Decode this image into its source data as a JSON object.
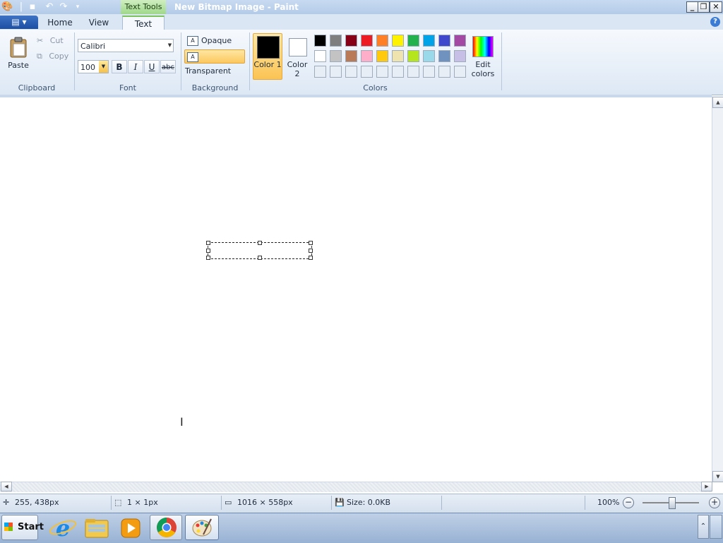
{
  "window": {
    "title": "New Bitmap Image - Paint",
    "contextual_tab": "Text Tools"
  },
  "tabs": [
    "Home",
    "View",
    "Text"
  ],
  "active_tab": "Text",
  "ribbon": {
    "clipboard": {
      "paste": "Paste",
      "cut": "Cut",
      "copy": "Copy",
      "label": "Clipboard"
    },
    "font": {
      "family": "Calibri",
      "size": "100",
      "bold": "B",
      "italic": "I",
      "underline": "U",
      "strike": "abc",
      "label": "Font"
    },
    "background": {
      "opaque": "Opaque",
      "transparent": "Transparent",
      "label": "Background",
      "selected": "Transparent"
    },
    "colors": {
      "color1_label": "Color 1",
      "color2_label": "Color 2",
      "edit_label": "Edit colors",
      "label": "Colors",
      "color1": "#000000",
      "color2": "#ffffff",
      "palette_row1": [
        "#000000",
        "#7f7f7f",
        "#880015",
        "#ed1c24",
        "#ff7f27",
        "#fff200",
        "#22b14c",
        "#00a2e8",
        "#3f48cc",
        "#a349a4"
      ],
      "palette_row2": [
        "#ffffff",
        "#c3c3c3",
        "#b97a57",
        "#ffaec9",
        "#ffc90e",
        "#efe4b0",
        "#b5e61d",
        "#99d9ea",
        "#7092be",
        "#c8bfe7"
      ],
      "palette_row3": [
        "#e8eef6",
        "#e8eef6",
        "#e8eef6",
        "#e8eef6",
        "#e8eef6",
        "#e8eef6",
        "#e8eef6",
        "#e8eef6",
        "#e8eef6",
        "#e8eef6"
      ]
    }
  },
  "status": {
    "cursor_pos": "255, 438px",
    "selection_size": "1 × 1px",
    "canvas_size": "1016 × 558px",
    "file_size": "Size: 0.0KB",
    "zoom": "100%",
    "zoom_level": 1.0
  },
  "taskbar": {
    "start": "Start",
    "apps": [
      "internet-explorer",
      "file-explorer",
      "media-player",
      "chrome",
      "paint"
    ]
  }
}
